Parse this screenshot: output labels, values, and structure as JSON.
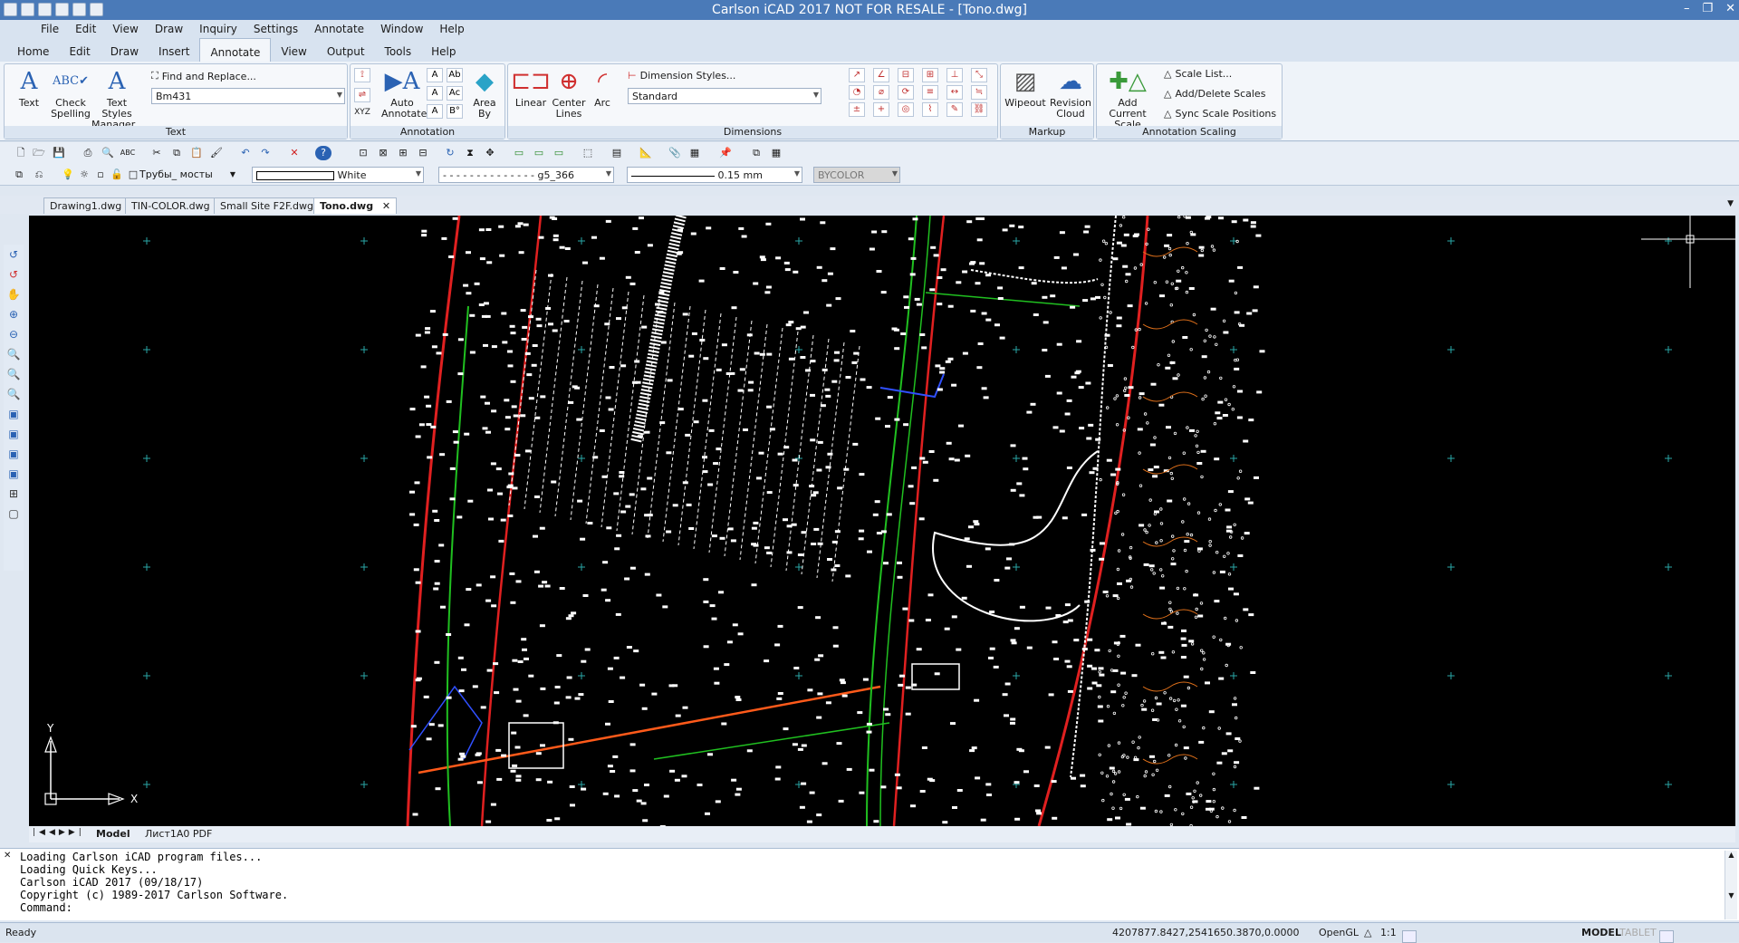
{
  "window": {
    "title": "Carlson iCAD 2017 NOT FOR RESALE  - [Tono.dwg]"
  },
  "menu": [
    "File",
    "Edit",
    "View",
    "Draw",
    "Inquiry",
    "Settings",
    "Annotate",
    "Window",
    "Help"
  ],
  "ribbon_tabs": [
    "Home",
    "Edit",
    "Draw",
    "Insert",
    "Annotate",
    "View",
    "Output",
    "Tools",
    "Help"
  ],
  "ribbon_active_tab": "Annotate",
  "text_group": {
    "label": "Text",
    "text_btn": "Text",
    "check_spelling": [
      "Check",
      "Spelling"
    ],
    "text_styles": [
      "Text Styles",
      "Manager..."
    ],
    "find_replace": "Find and Replace...",
    "style_value": "Bm431"
  },
  "annotation_group": {
    "label": "Annotation",
    "auto_annotate": [
      "Auto",
      "Annotate"
    ],
    "area_by": [
      "Area",
      "By"
    ],
    "xyz": "XYZ"
  },
  "dimensions_group": {
    "label": "Dimensions",
    "linear": "Linear",
    "center_lines": [
      "Center",
      "Lines"
    ],
    "arc": "Arc",
    "dimension_styles": "Dimension Styles...",
    "dim_style_value": "Standard"
  },
  "markup_group": {
    "label": "Markup",
    "wipeout": "Wipeout",
    "revision_cloud": [
      "Revision",
      "Cloud"
    ]
  },
  "scaling_group": {
    "label": "Annotation Scaling",
    "add_current_scale": [
      "Add Current",
      "Scale"
    ],
    "scale_list": "Scale List...",
    "add_delete": "Add/Delete Scales",
    "sync": "Sync Scale Positions"
  },
  "properties": {
    "layer": "Трубы_ мосты",
    "color": "White",
    "linetype": "g5_366",
    "lineweight": "0.15 mm",
    "plotstyle": "BYCOLOR"
  },
  "doc_tabs": [
    "Drawing1.dwg",
    "TIN-COLOR.dwg",
    "Small Site F2F.dwg",
    "Tono.dwg"
  ],
  "active_doc": "Tono.dwg",
  "layout_tabs": [
    "Model",
    "Лист1A0 PDF"
  ],
  "ucs": {
    "x": "X",
    "y": "Y"
  },
  "command_lines": [
    "Loading Carlson iCAD program files...",
    "Loading Quick Keys...",
    "Carlson iCAD 2017 (09/18/17)",
    "Copyright (c) 1989-2017 Carlson Software.",
    "Command:"
  ],
  "status": {
    "ready": "Ready",
    "coords": "4207877.8427,2541650.3870,0.0000",
    "opengl": "OpenGL",
    "scale": "1:1",
    "model": "MODEL",
    "tablet": "TABLET"
  },
  "colors": {
    "title_bar": "#4a7ab8",
    "canvas": "#000000",
    "accent": "#2a62b3"
  }
}
